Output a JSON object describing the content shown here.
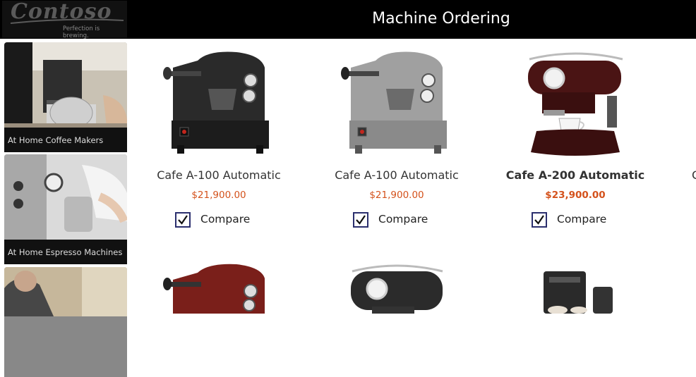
{
  "header": {
    "logo_text": "Contoso",
    "logo_tagline": "Perfection is brewing.",
    "title": "Machine Ordering"
  },
  "sidebar": {
    "categories": [
      {
        "label": "At Home Coffee Makers"
      },
      {
        "label": "At Home Espresso Machines"
      },
      {
        "label": ""
      }
    ]
  },
  "products": [
    {
      "name": "Cafe A-100 Automatic",
      "price": "$21,900.00",
      "compare_label": "Compare",
      "compare_checked": true,
      "color": "#2a2a2a"
    },
    {
      "name": "Cafe A-100 Automatic",
      "price": "$21,900.00",
      "compare_label": "Compare",
      "compare_checked": true,
      "color": "#8c8c8c"
    },
    {
      "name": "Cafe A-200 Automatic",
      "price": "$23,900.00",
      "compare_label": "Compare",
      "compare_checked": true,
      "color": "#4a1414"
    },
    {
      "name": "C",
      "price": "",
      "compare_label": "",
      "compare_checked": false,
      "color": "#333333"
    }
  ],
  "colors": {
    "header_bg": "#000000",
    "price": "#d4521c",
    "checkbox_border": "#2b2f6e"
  },
  "icons": [
    "checkmark-icon"
  ]
}
